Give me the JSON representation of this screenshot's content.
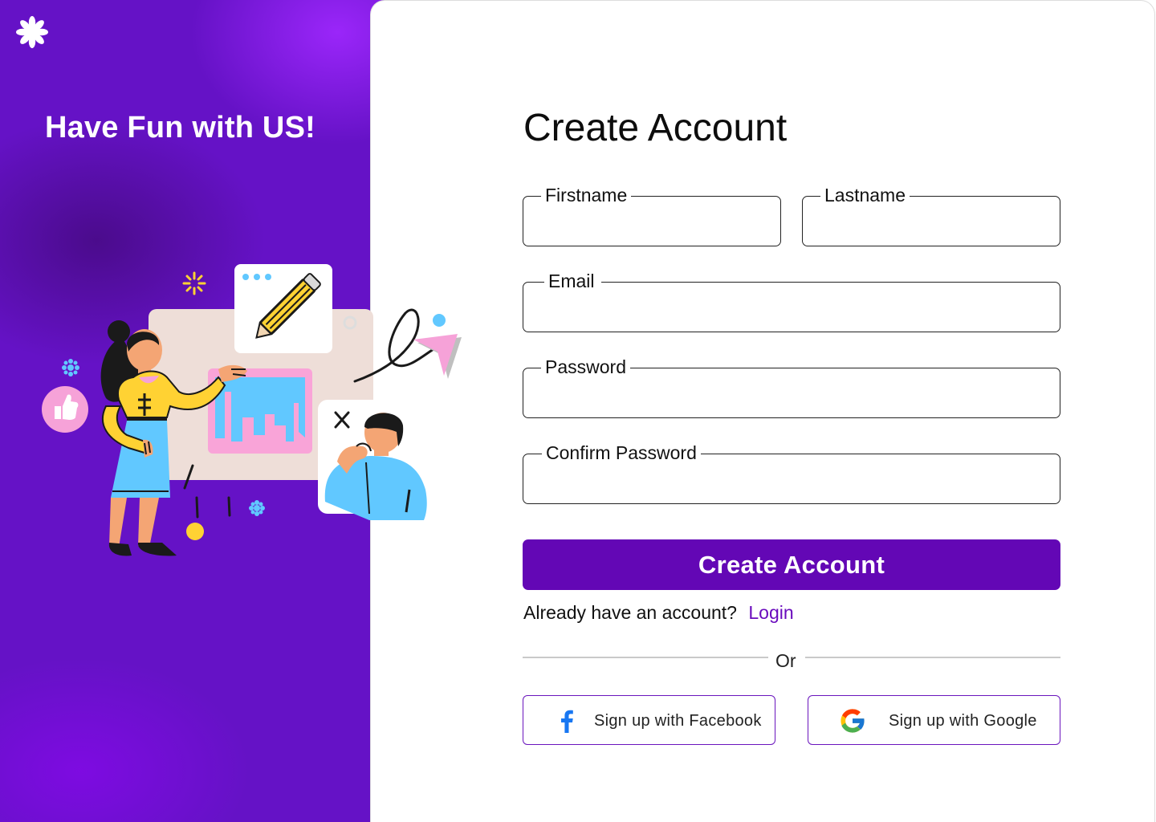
{
  "hero": {
    "title": "Have Fun with US!",
    "logo_icon": "asterisk-flower-icon"
  },
  "form": {
    "title": "Create Account",
    "fields": {
      "firstname": {
        "label": "Firstname",
        "value": ""
      },
      "lastname": {
        "label": "Lastname",
        "value": ""
      },
      "email": {
        "label": "Email",
        "value": ""
      },
      "password": {
        "label": "Password",
        "value": ""
      },
      "confirm_password": {
        "label": "Confirm Password",
        "value": ""
      }
    },
    "submit_label": "Create Account",
    "login_prompt": "Already have an account?",
    "login_link": "Login",
    "divider_text": "Or",
    "social": {
      "facebook": {
        "label": "Sign up with Facebook",
        "icon": "facebook-icon"
      },
      "google": {
        "label": "Sign up with Google",
        "icon": "google-icon"
      }
    }
  },
  "colors": {
    "brand_purple": "#6307b5",
    "panel_purple": "#6512c6",
    "link_purple": "#6a0bbd",
    "facebook_blue": "#1877f2"
  }
}
